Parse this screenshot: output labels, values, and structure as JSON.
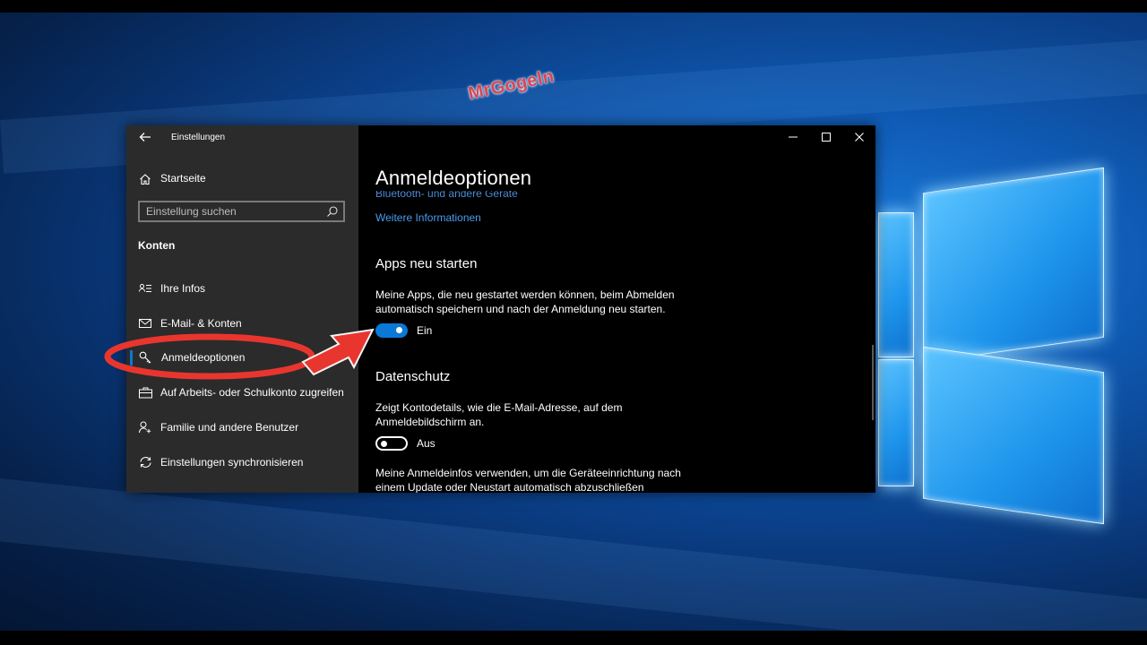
{
  "watermark": "MrGogeln",
  "window": {
    "title": "Einstellungen",
    "controls": {
      "minimize": "minimize-icon",
      "maximize": "maximize-icon",
      "close": "close-icon"
    }
  },
  "sidebar": {
    "home_label": "Startseite",
    "search_placeholder": "Einstellung suchen",
    "section_heading": "Konten",
    "items": [
      {
        "label": "Ihre Infos",
        "icon": "person-card-icon"
      },
      {
        "label": "E-Mail- & Konten",
        "icon": "mail-icon"
      },
      {
        "label": "Anmeldeoptionen",
        "icon": "key-icon",
        "selected": true
      },
      {
        "label": "Auf Arbeits- oder Schulkonto zugreifen",
        "icon": "briefcase-icon"
      },
      {
        "label": "Familie und andere Benutzer",
        "icon": "person-add-icon"
      },
      {
        "label": "Einstellungen synchronisieren",
        "icon": "sync-icon"
      }
    ]
  },
  "content": {
    "page_title": "Anmeldeoptionen",
    "clipped_text": "Bluetooth- und andere Geräte",
    "more_info_link": "Weitere Informationen",
    "apps_restart": {
      "heading": "Apps neu starten",
      "description": "Meine Apps, die neu gestartet werden können, beim Abmelden automatisch speichern und nach der Anmeldung neu starten.",
      "toggle_state": "on",
      "toggle_label": "Ein"
    },
    "privacy": {
      "heading": "Datenschutz",
      "description": "Zeigt Kontodetails, wie die E-Mail-Adresse, auf dem Anmeldebildschirm an.",
      "toggle_state": "off",
      "toggle_label": "Aus",
      "description2": "Meine Anmeldeinfos verwenden, um die Geräteeinrichtung nach einem Update oder Neustart automatisch abzuschließen"
    }
  },
  "colors": {
    "accent": "#0a78d7",
    "link": "#4a9cf0",
    "annotation": "#e8362f",
    "sidebar_bg": "#2b2b2b",
    "content_bg": "#000000"
  }
}
